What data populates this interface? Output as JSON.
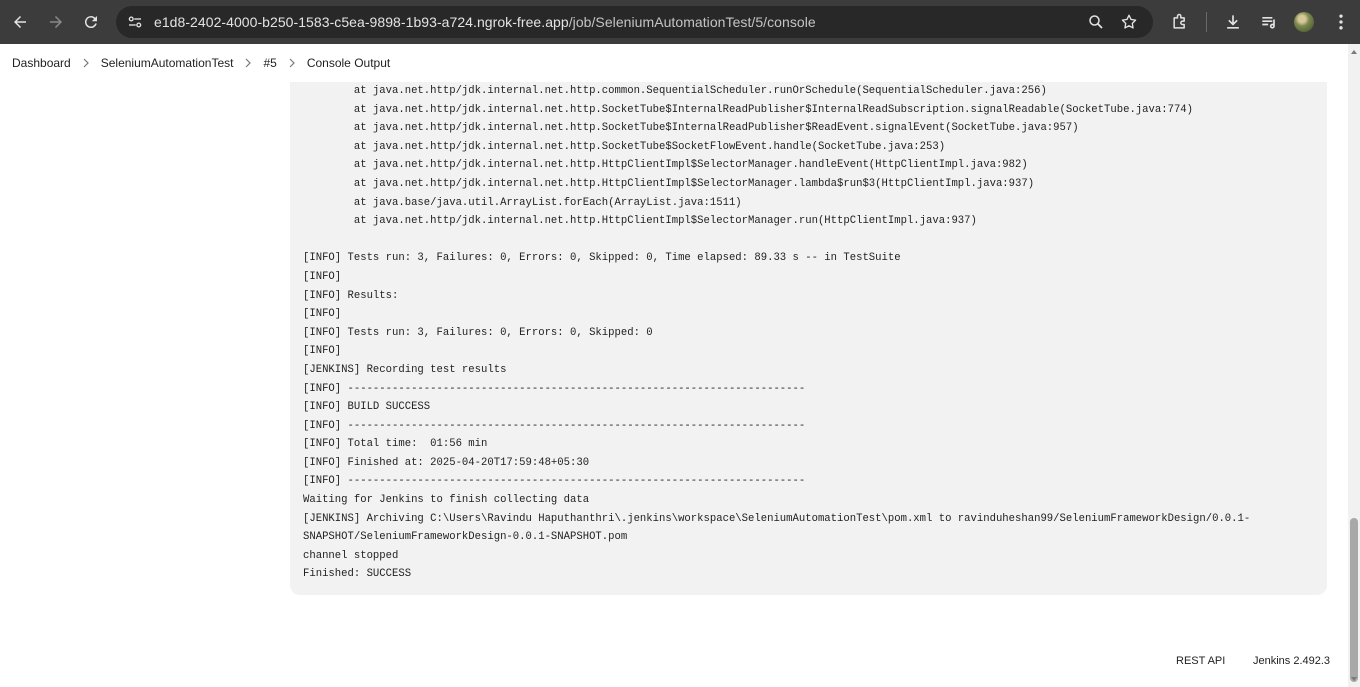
{
  "browser": {
    "url_host": "e1d8-2402-4000-b250-1583-c5ea-9898-1b93-a724.ngrok-free.app",
    "url_path": "/job/SeleniumAutomationTest/5/console",
    "icons": [
      "back-icon",
      "forward-icon",
      "reload-icon",
      "site-info-icon",
      "zoom-icon",
      "bookmark-star-icon",
      "extensions-icon",
      "download-icon",
      "media-queue-icon",
      "profile-avatar",
      "menu-kebab-icon"
    ]
  },
  "breadcrumb": {
    "items": [
      "Dashboard",
      "SeleniumAutomationTest",
      "#5",
      "Console Output"
    ]
  },
  "console": {
    "lines": [
      "        at java.net.http/jdk.internal.net.http.common.SequentialScheduler.runOrSchedule(SequentialScheduler.java:256)",
      "        at java.net.http/jdk.internal.net.http.SocketTube$InternalReadPublisher$InternalReadSubscription.signalReadable(SocketTube.java:774)",
      "        at java.net.http/jdk.internal.net.http.SocketTube$InternalReadPublisher$ReadEvent.signalEvent(SocketTube.java:957)",
      "        at java.net.http/jdk.internal.net.http.SocketTube$SocketFlowEvent.handle(SocketTube.java:253)",
      "        at java.net.http/jdk.internal.net.http.HttpClientImpl$SelectorManager.handleEvent(HttpClientImpl.java:982)",
      "        at java.net.http/jdk.internal.net.http.HttpClientImpl$SelectorManager.lambda$run$3(HttpClientImpl.java:937)",
      "        at java.base/java.util.ArrayList.forEach(ArrayList.java:1511)",
      "        at java.net.http/jdk.internal.net.http.HttpClientImpl$SelectorManager.run(HttpClientImpl.java:937)",
      "",
      "[INFO] Tests run: 3, Failures: 0, Errors: 0, Skipped: 0, Time elapsed: 89.33 s -- in TestSuite",
      "[INFO]",
      "[INFO] Results:",
      "[INFO]",
      "[INFO] Tests run: 3, Failures: 0, Errors: 0, Skipped: 0",
      "[INFO]",
      "[JENKINS] Recording test results",
      "[INFO] ------------------------------------------------------------------------",
      "[INFO] BUILD SUCCESS",
      "[INFO] ------------------------------------------------------------------------",
      "[INFO] Total time:  01:56 min",
      "[INFO] Finished at: 2025-04-20T17:59:48+05:30",
      "[INFO] ------------------------------------------------------------------------",
      "Waiting for Jenkins to finish collecting data",
      "[JENKINS] Archiving C:\\Users\\Ravindu Haputhanthri\\.jenkins\\workspace\\SeleniumAutomationTest\\pom.xml to ravinduheshan99/SeleniumFrameworkDesign/0.0.1-",
      "SNAPSHOT/SeleniumFrameworkDesign-0.0.1-SNAPSHOT.pom",
      "channel stopped",
      "Finished: SUCCESS"
    ]
  },
  "footer": {
    "rest_api": "REST API",
    "version": "Jenkins 2.492.3"
  },
  "colors": {
    "browser_bar": "#3c3c3c",
    "omnibox": "#282828",
    "console_bg": "#f2f2f2"
  }
}
